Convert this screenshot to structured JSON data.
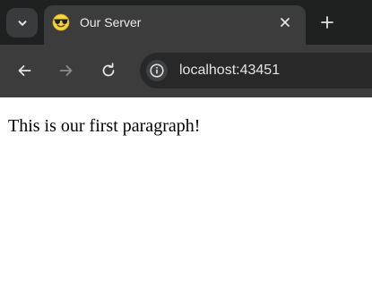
{
  "browser": {
    "tab": {
      "title": "Our Server",
      "favicon": "sunglasses-emoji-icon"
    },
    "toolbar": {
      "url": "localhost:43451"
    }
  },
  "page": {
    "paragraph": "This is our first paragraph!"
  },
  "colors": {
    "tab_strip_bg": "#1f2020",
    "tab_bg": "#3c3c3c",
    "toolbar_bg": "#3c3c3c",
    "omnibox_bg": "#282828",
    "icon_color": "#e3e3e3",
    "disabled_icon_color": "#8a8a8a",
    "page_bg": "#ffffff",
    "page_text": "#000000"
  }
}
